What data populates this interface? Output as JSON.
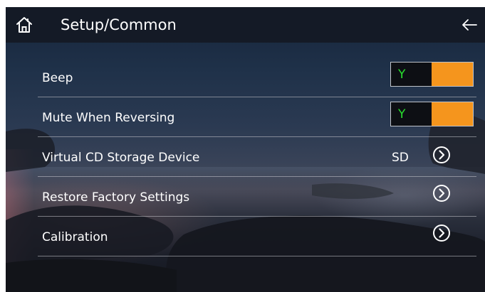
{
  "header": {
    "title": "Setup/Common",
    "home_icon": "home-icon",
    "back_icon": "back-arrow-icon"
  },
  "settings": [
    {
      "label": "Beep",
      "control": "toggle",
      "value": "Y"
    },
    {
      "label": "Mute When Reversing",
      "control": "toggle",
      "value": "Y"
    },
    {
      "label": "Virtual CD Storage Device",
      "control": "value-arrow",
      "value": "SD"
    },
    {
      "label": "Restore Factory Settings",
      "control": "arrow"
    },
    {
      "label": "Calibration",
      "control": "arrow"
    }
  ],
  "colors": {
    "toggle_on": "#f5951d",
    "toggle_text": "#28e22e",
    "header_bg": "#141a26"
  }
}
